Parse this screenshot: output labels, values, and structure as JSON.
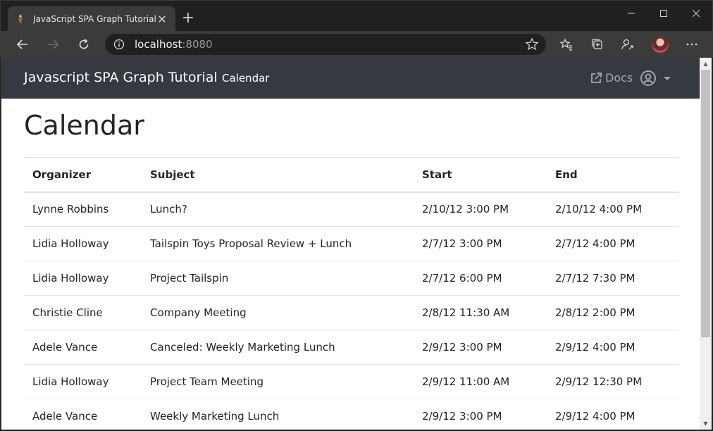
{
  "browser": {
    "tab_title": "JavaScript SPA Graph Tutorial",
    "tab_close": "✕",
    "new_tab": "+",
    "address_host": "localhost",
    "address_port": ":8080"
  },
  "navbar": {
    "brand": "Javascript SPA Graph Tutorial",
    "link": "Calendar",
    "docs_label": "Docs"
  },
  "page": {
    "title": "Calendar"
  },
  "table": {
    "headers": [
      "Organizer",
      "Subject",
      "Start",
      "End"
    ],
    "rows": [
      [
        "Lynne Robbins",
        "Lunch?",
        "2/10/12 3:00 PM",
        "2/10/12 4:00 PM"
      ],
      [
        "Lidia Holloway",
        "Tailspin Toys Proposal Review + Lunch",
        "2/7/12 3:00 PM",
        "2/7/12 4:00 PM"
      ],
      [
        "Lidia Holloway",
        "Project Tailspin",
        "2/7/12 6:00 PM",
        "2/7/12 7:30 PM"
      ],
      [
        "Christie Cline",
        "Company Meeting",
        "2/8/12 11:30 AM",
        "2/8/12 2:00 PM"
      ],
      [
        "Adele Vance",
        "Canceled: Weekly Marketing Lunch",
        "2/9/12 3:00 PM",
        "2/9/12 4:00 PM"
      ],
      [
        "Lidia Holloway",
        "Project Team Meeting",
        "2/9/12 11:00 AM",
        "2/9/12 12:30 PM"
      ],
      [
        "Adele Vance",
        "Weekly Marketing Lunch",
        "2/9/12 3:00 PM",
        "2/9/12 4:00 PM"
      ]
    ]
  },
  "colors": {
    "navbar_bg": "#343a40",
    "chrome_bg": "#202020",
    "toolbar_bg": "#3b3b3b",
    "docs_color": "#a3a6a9"
  },
  "icons": [
    "tab-favicon-icon",
    "back-arrow-icon",
    "forward-arrow-icon",
    "refresh-icon",
    "info-icon",
    "star-icon",
    "favorites-icon",
    "collections-icon",
    "share-icon",
    "more-icon",
    "external-link-icon",
    "user-circle-icon",
    "caret-down-icon",
    "minimize-icon",
    "maximize-icon",
    "close-window-icon"
  ]
}
